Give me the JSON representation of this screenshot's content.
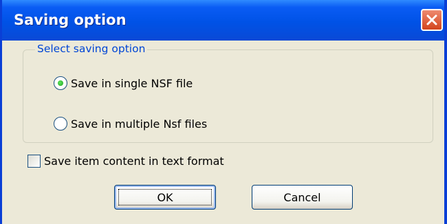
{
  "window": {
    "title": "Saving option"
  },
  "options_group": {
    "legend": "Select saving option",
    "options": [
      {
        "label": "Save in single NSF file",
        "selected": true
      },
      {
        "label": "Save in multiple Nsf files",
        "selected": false
      }
    ]
  },
  "text_format_checkbox": {
    "label": "Save item content in text format",
    "checked": false
  },
  "buttons": {
    "ok": "OK",
    "cancel": "Cancel"
  },
  "colors": {
    "titlebar": "#0052e6",
    "close": "#d3441c",
    "dialog": "#ece9d8",
    "legend_text": "#0046d5"
  }
}
